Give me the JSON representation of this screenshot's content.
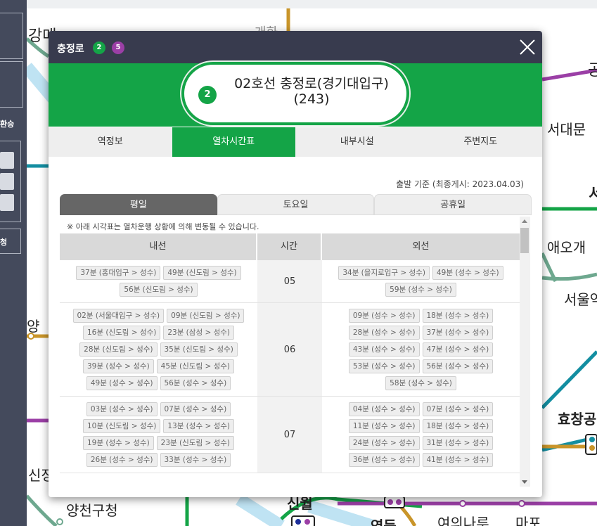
{
  "map": {
    "labels": [
      "강매",
      "개화",
      "공",
      "서대문",
      "서",
      "애오개",
      "서울역",
      "양",
      "효창공",
      "신정",
      "양천구청",
      "신월",
      "영등",
      "여의나루",
      "마포"
    ]
  },
  "sidepanel": {
    "transfer_label": "환승",
    "bottom_label": "청"
  },
  "popup": {
    "station_title": "충정로",
    "line_badges": [
      {
        "label": "2",
        "color": "#14a447"
      },
      {
        "label": "5",
        "color": "#9b3fa6"
      }
    ],
    "close_icon": "close-icon",
    "pill": {
      "line_label": "2",
      "station_name": "02호선 충정로(경기대입구) (243)"
    },
    "tabs": [
      "역정보",
      "열차시간표",
      "내부시설",
      "주변지도"
    ],
    "active_tab": 1,
    "basis_note": "출발 기준 (최종게시: 2023.04.03)",
    "day_tabs": [
      "평일",
      "토요일",
      "공휴일"
    ],
    "active_day": 0,
    "notice": "※ 아래 시각표는 열차운행 상황에 의해 변동될 수 있습니다.",
    "table": {
      "headers": [
        "내선",
        "시간",
        "외선"
      ],
      "rows": [
        {
          "hour": "05",
          "inner": [
            "37분 (홍대입구 > 성수)",
            "49분 (신도림 > 성수)",
            "56분 (신도림 > 성수)"
          ],
          "outer": [
            "34분 (을지로입구 > 성수)",
            "49분 (성수 > 성수)",
            "59분 (성수 > 성수)"
          ]
        },
        {
          "hour": "06",
          "inner": [
            "02분 (서울대입구 > 성수)",
            "09분 (신도림 > 성수)",
            "16분 (신도림 > 성수)",
            "23분 (삼성 > 성수)",
            "28분 (신도림 > 성수)",
            "35분 (신도림 > 성수)",
            "39분 (성수 > 성수)",
            "45분 (신도림 > 성수)",
            "49분 (성수 > 성수)",
            "56분 (성수 > 성수)"
          ],
          "outer": [
            "09분 (성수 > 성수)",
            "18분 (성수 > 성수)",
            "28분 (성수 > 성수)",
            "37분 (성수 > 성수)",
            "43분 (성수 > 성수)",
            "47분 (성수 > 성수)",
            "53분 (성수 > 성수)",
            "56분 (성수 > 성수)",
            "58분 (성수 > 성수)"
          ]
        },
        {
          "hour": "07",
          "inner": [
            "03분 (성수 > 성수)",
            "07분 (성수 > 성수)",
            "10분 (신도림 > 성수)",
            "13분 (성수 > 성수)",
            "19분 (성수 > 성수)",
            "23분 (신도림 > 성수)",
            "26분 (성수 > 성수)",
            "33분 (성수 > 성수)"
          ],
          "outer": [
            "04분 (성수 > 성수)",
            "07분 (성수 > 성수)",
            "11분 (성수 > 성수)",
            "18분 (성수 > 성수)",
            "24분 (성수 > 성수)",
            "31분 (성수 > 성수)",
            "36분 (성수 > 성수)",
            "41분 (성수 > 성수)"
          ]
        }
      ]
    }
  },
  "colors": {
    "line2": "#14a447",
    "line5": "#9b3fa6",
    "header_bg": "#383b4e",
    "sidepanel_bg": "#444a5c"
  }
}
